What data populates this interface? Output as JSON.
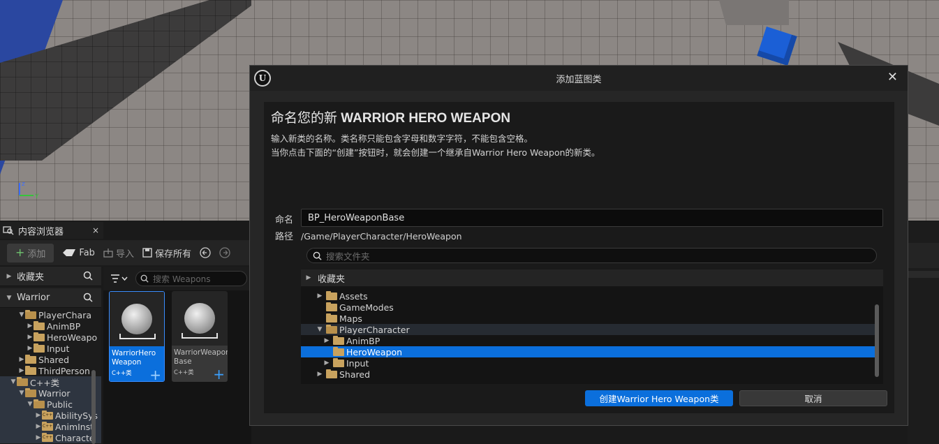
{
  "content_browser": {
    "tab_label": "内容浏览器",
    "tab_close": "×",
    "toolbar": {
      "add_label": "添加",
      "fab_label": "Fab",
      "import_label": "导入",
      "save_all_label": "保存所有"
    },
    "favorites_label": "收藏夹",
    "project_label": "Warrior",
    "tree": [
      {
        "label": "PlayerChara",
        "depth": 1,
        "expanded": true
      },
      {
        "label": "AnimBP",
        "depth": 2,
        "expanded": false
      },
      {
        "label": "HeroWeapo",
        "depth": 2,
        "expanded": false
      },
      {
        "label": "Input",
        "depth": 2,
        "expanded": false
      },
      {
        "label": "Shared",
        "depth": 1,
        "expanded": false
      },
      {
        "label": "ThirdPerson",
        "depth": 1,
        "expanded": false
      },
      {
        "label": "C++类",
        "depth": 0,
        "expanded": true
      },
      {
        "label": "Warrior",
        "depth": 1,
        "expanded": true
      },
      {
        "label": "Public",
        "depth": 2,
        "expanded": true
      },
      {
        "label": "AbilitySys",
        "depth": 3,
        "expanded": false
      },
      {
        "label": "AnimInst",
        "depth": 3,
        "expanded": false
      },
      {
        "label": "Characte",
        "depth": 3,
        "expanded": false
      }
    ],
    "search_placeholder": "搜索 Weapons",
    "assets": [
      {
        "name": "WarriorHero Weapon",
        "type": "C++类",
        "selected": true
      },
      {
        "name": "WarriorWeapon Base",
        "type": "C++类",
        "selected": false
      }
    ]
  },
  "dialog": {
    "title": "添加蓝图类",
    "logo": "U",
    "close_icon": "✕",
    "heading_prefix": "命名您的新",
    "heading_class": "WARRIOR HERO WEAPON",
    "description_line1": "输入新类的名称。类名称只能包含字母和数字字符，不能包含空格。",
    "description_line2": "当你点击下面的“创建”按钮时，就会创建一个继承自Warrior Hero Weapon的新类。",
    "name_label": "命名",
    "name_value": "BP_HeroWeaponBase",
    "path_label": "路径",
    "path_value": "/Game/PlayerCharacter/HeroWeapon",
    "folder_search_placeholder": "搜索文件夹",
    "favorites_label": "收藏夹",
    "folders": [
      {
        "label": "Assets",
        "depth": 1,
        "expanded": false,
        "state": "normal"
      },
      {
        "label": "GameModes",
        "depth": 1,
        "expanded": null,
        "state": "normal"
      },
      {
        "label": "Maps",
        "depth": 1,
        "expanded": null,
        "state": "normal"
      },
      {
        "label": "PlayerCharacter",
        "depth": 1,
        "expanded": true,
        "state": "hover"
      },
      {
        "label": "AnimBP",
        "depth": 2,
        "expanded": false,
        "state": "normal"
      },
      {
        "label": "HeroWeapon",
        "depth": 2,
        "expanded": null,
        "state": "selected"
      },
      {
        "label": "Input",
        "depth": 2,
        "expanded": false,
        "state": "normal"
      },
      {
        "label": "Shared",
        "depth": 1,
        "expanded": false,
        "state": "normal"
      }
    ],
    "create_button_label": "创建Warrior Hero Weapon类",
    "cancel_button_label": "取消"
  },
  "colors": {
    "accent": "#0b6fdc",
    "folder": "#c8a25e",
    "blue_cube": "#1b5fd6",
    "panel_bg": "#1a1a1a"
  }
}
